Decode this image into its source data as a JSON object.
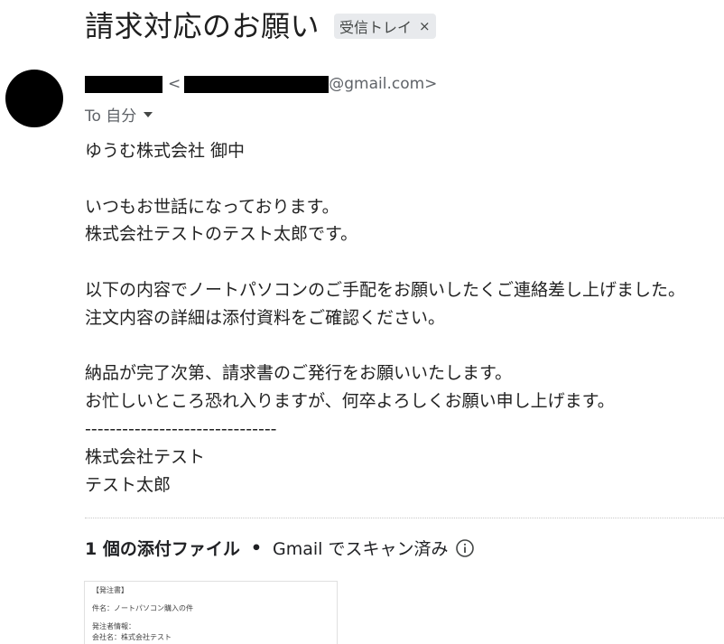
{
  "email": {
    "subject": "請求対応のお願い",
    "label": "受信トレイ",
    "label_close": "×",
    "sender_open": "<",
    "sender_domain": "@gmail.com>",
    "to_label": "To 自分",
    "body_lines": [
      "ゆうむ株式会社 御中",
      "",
      "いつもお世話になっております。",
      "株式会社テストのテスト太郎です。",
      "",
      "以下の内容でノートパソコンのご手配をお願いしたくご連絡差し上げました。",
      "注文内容の詳細は添付資料をご確認ください。",
      "",
      "納品が完了次第、請求書のご発行をお願いいたします。",
      "お忙しいところ恐れ入りますが、何卒よろしくお願い申し上げます。",
      "-------------------------------",
      "株式会社テスト",
      "テスト太郎"
    ]
  },
  "attachments": {
    "count_label": "1 個の添付ファイル",
    "separator": "•",
    "scan_label": "Gmail でスキャン済み",
    "thumbnail_lines": [
      "【発注書】",
      "",
      "件名：ノートパソコン購入の件",
      "",
      "発注者情報：",
      "会社名：株式会社テスト"
    ]
  }
}
